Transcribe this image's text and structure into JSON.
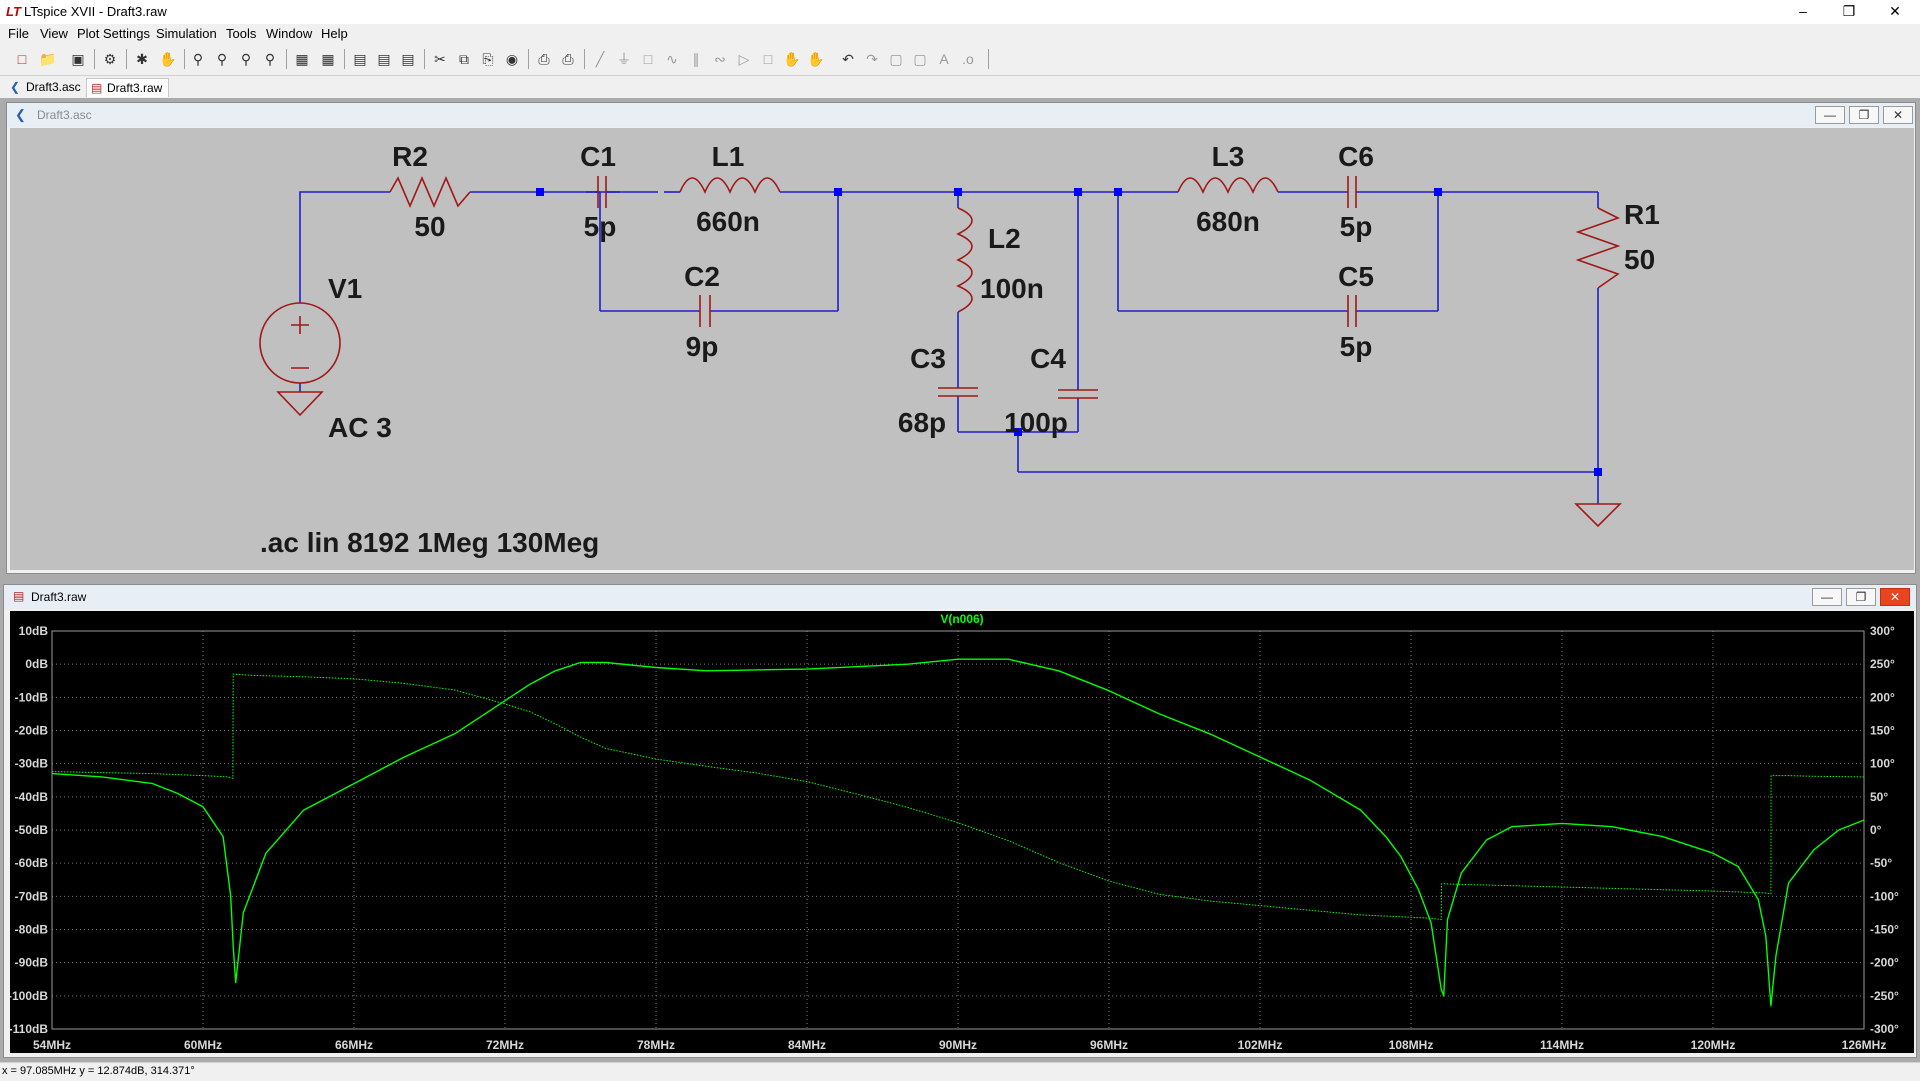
{
  "window": {
    "title": "LTspice XVII - Draft3.raw",
    "controls": {
      "minimize": "–",
      "restore": "❐",
      "close": "✕"
    }
  },
  "menu": [
    "File",
    "View",
    "Plot Settings",
    "Simulation",
    "Tools",
    "Window",
    "Help"
  ],
  "tabs": [
    {
      "label": "Draft3.asc",
      "active": false,
      "icon": "schematic-icon"
    },
    {
      "label": "Draft3.raw",
      "active": true,
      "icon": "waveform-icon"
    }
  ],
  "schematic_window": {
    "title": "Draft3.asc",
    "components": [
      {
        "ref": "R2",
        "value": "50"
      },
      {
        "ref": "C1",
        "value": "5p"
      },
      {
        "ref": "L1",
        "value": "660n"
      },
      {
        "ref": "C2",
        "value": "9p"
      },
      {
        "ref": "L2",
        "value": "100n"
      },
      {
        "ref": "C3",
        "value": "68p"
      },
      {
        "ref": "C4",
        "value": "100p"
      },
      {
        "ref": "L3",
        "value": "680n"
      },
      {
        "ref": "C6",
        "value": "5p"
      },
      {
        "ref": "C5",
        "value": "5p"
      },
      {
        "ref": "R1",
        "value": "50"
      },
      {
        "ref": "V1",
        "value": "AC 3"
      }
    ],
    "directive": ".ac lin 8192 1Meg 130Meg",
    "colors": {
      "wire": "#2020c8",
      "junction": "#0000ff",
      "component": "#a01818",
      "text": "#1a1a1a"
    }
  },
  "plot_window": {
    "title": "Draft3.raw",
    "trace_label": "V(n006)",
    "trace_color": "#00ff00"
  },
  "chart_data": {
    "type": "line",
    "title": "",
    "xlabel": "",
    "ylabel": "",
    "x_ticks": [
      "54MHz",
      "60MHz",
      "66MHz",
      "72MHz",
      "78MHz",
      "84MHz",
      "90MHz",
      "96MHz",
      "102MHz",
      "108MHz",
      "114MHz",
      "120MHz",
      "126MHz"
    ],
    "y_ticks_left": [
      "10dB",
      "0dB",
      "-10dB",
      "-20dB",
      "-30dB",
      "-40dB",
      "-50dB",
      "-60dB",
      "-70dB",
      "-80dB",
      "-90dB",
      "-100dB",
      "-110dB"
    ],
    "y_ticks_right": [
      "300°",
      "250°",
      "200°",
      "150°",
      "100°",
      "50°",
      "0°",
      "-50°",
      "-100°",
      "-150°",
      "-200°",
      "-250°",
      "-300°"
    ],
    "xlim": [
      54,
      126
    ],
    "ylim_left": [
      -110,
      10
    ],
    "ylim_right": [
      -300,
      300
    ],
    "grid": true,
    "series": [
      {
        "name": "V(n006)",
        "axis": "left",
        "style": "solid",
        "x": [
          54,
          56,
          58,
          59,
          60,
          60.8,
          61.1,
          61.2,
          61.3,
          61.6,
          62.5,
          64,
          66,
          68,
          70,
          72,
          73,
          74,
          75,
          76,
          78,
          80,
          84,
          88,
          90,
          92,
          94,
          96,
          98,
          100,
          102,
          104,
          106,
          107,
          107.6,
          108.3,
          108.8,
          109.2,
          109.3,
          109.45,
          110,
          111,
          112,
          114,
          116,
          118,
          120,
          121,
          121.8,
          122.1,
          122.3,
          122.5,
          123,
          124,
          125,
          126
        ],
        "y": [
          -33,
          -34,
          -36,
          -39,
          -43,
          -52,
          -70,
          -85,
          -96,
          -75,
          -57,
          -44,
          -36,
          -28,
          -21,
          -11,
          -6,
          -2,
          0.5,
          0.5,
          -1,
          -2,
          -1.5,
          0,
          1.5,
          1.5,
          -2,
          -8,
          -15,
          -21,
          -28,
          -35,
          -44,
          -52,
          -58,
          -68,
          -78,
          -98,
          -100,
          -77,
          -63,
          -53,
          -49,
          -48,
          -49,
          -52,
          -57,
          -61,
          -71,
          -82,
          -103,
          -88,
          -66,
          -56,
          -50,
          -47
        ]
      },
      {
        "name": "V(n006) phase",
        "axis": "right",
        "style": "dotted",
        "x": [
          54,
          58,
          60,
          61,
          61.19,
          61.2,
          62,
          64,
          66,
          68,
          70,
          72,
          73,
          74,
          75,
          76,
          78,
          80,
          82,
          84,
          86,
          88,
          90,
          92,
          94,
          96,
          98,
          100,
          102,
          104,
          106,
          108.8,
          109.2,
          109.21,
          110,
          112,
          114,
          116,
          118,
          120,
          122.1,
          122.3,
          122.31,
          123,
          124,
          126
        ],
        "y": [
          88,
          85,
          82,
          80,
          78,
          235,
          233,
          231,
          228,
          221,
          211,
          190,
          178,
          160,
          140,
          123,
          107,
          96,
          86,
          73,
          54,
          34,
          11,
          -16,
          -49,
          -77,
          -97,
          -107,
          -114,
          -121,
          -128,
          -133,
          -135,
          -81,
          -82,
          -84,
          -86,
          -88,
          -90,
          -92,
          -95,
          -96,
          82,
          82,
          81,
          80
        ]
      }
    ]
  },
  "status": "x = 97.085MHz    y = 12.874dB, 314.371°"
}
